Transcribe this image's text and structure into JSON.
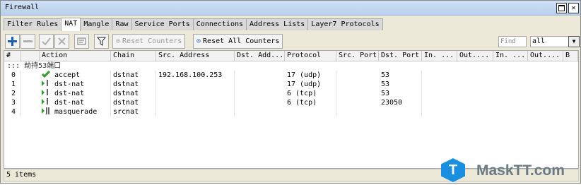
{
  "window": {
    "title": "Firewall"
  },
  "tabs": [
    {
      "label": "Filter Rules"
    },
    {
      "label": "NAT"
    },
    {
      "label": "Mangle"
    },
    {
      "label": "Raw"
    },
    {
      "label": "Service Ports"
    },
    {
      "label": "Connections"
    },
    {
      "label": "Address Lists"
    },
    {
      "label": "Layer7 Protocols"
    }
  ],
  "active_tab": "NAT",
  "toolbar": {
    "reset_counters": "Reset Counters",
    "reset_all_counters": "Reset All Counters",
    "find_placeholder": "Find",
    "filter_value": "all"
  },
  "table": {
    "headers": [
      "#",
      "Action",
      "Chain",
      "Src. Address",
      "Dst. Add...",
      "Protocol",
      "Src. Port",
      "Dst. Port",
      "In. ...",
      "Out....",
      "In. ...",
      "Out....",
      "B"
    ],
    "comment": "::: 劫持53端口",
    "rows": [
      {
        "num": "0",
        "action": "accept",
        "chain": "dstnat",
        "src_address": "192.168.100.253",
        "protocol": "17 (udp)",
        "dst_port": "53"
      },
      {
        "num": "1",
        "action": "dst-nat",
        "chain": "dstnat",
        "src_address": "",
        "protocol": "17 (udp)",
        "dst_port": "53"
      },
      {
        "num": "2",
        "action": "dst-nat",
        "chain": "dstnat",
        "src_address": "",
        "protocol": "6 (tcp)",
        "dst_port": "53"
      },
      {
        "num": "3",
        "action": "dst-nat",
        "chain": "dstnat",
        "src_address": "",
        "protocol": "6 (tcp)",
        "dst_port": "23050"
      },
      {
        "num": "4",
        "action": "masquerade",
        "chain": "srcnat",
        "src_address": "",
        "protocol": "",
        "dst_port": ""
      }
    ]
  },
  "status": {
    "items": "5 items"
  },
  "watermark": {
    "logo_letter": "T",
    "brand": "MaskTT.com"
  },
  "colors": {
    "accept": "#2e9e2e",
    "add": "#1a5fb4",
    "brand": "#1a8fe0"
  }
}
